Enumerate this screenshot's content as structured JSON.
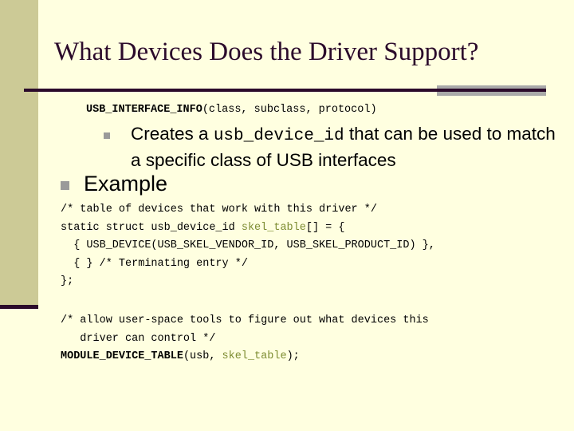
{
  "slide": {
    "title": "What Devices Does the Driver Support?",
    "accent_dark": "#2b0a2b",
    "accent_khaki": "#ccca96",
    "background": "#ffffe0",
    "tab_gray": "#a9a9a9",
    "bullet_gray": "#9a9a9a",
    "token_green": "#7d8c31"
  },
  "content": {
    "macro_line": {
      "bold_part": "USB_INTERFACE_INFO",
      "rest_part": "(class, subclass, protocol)"
    },
    "sub_bullet": {
      "text_before": "Creates a ",
      "mono": "usb_device_id",
      "text_after": " that can be used to match a specific class of USB interfaces"
    },
    "main_bullet": {
      "label": "Example"
    },
    "code_block_1": {
      "line_1": "/* table of devices that work with this driver */",
      "line_2_a": "static struct usb_device_id ",
      "line_2_green": "skel_table",
      "line_2_b": "[] = {",
      "line_3": "  { USB_DEVICE(USB_SKEL_VENDOR_ID, USB_SKEL_PRODUCT_ID) },",
      "line_4": "  { } /* Terminating entry */",
      "line_5": "};"
    },
    "code_block_2": {
      "line_1": "/* allow user-space tools to figure out what devices this",
      "line_2": "   driver can control */",
      "line_3_bold": "MODULE_DEVICE_TABLE",
      "line_3_a": "(usb, ",
      "line_3_green": "skel_table",
      "line_3_b": ");"
    }
  }
}
